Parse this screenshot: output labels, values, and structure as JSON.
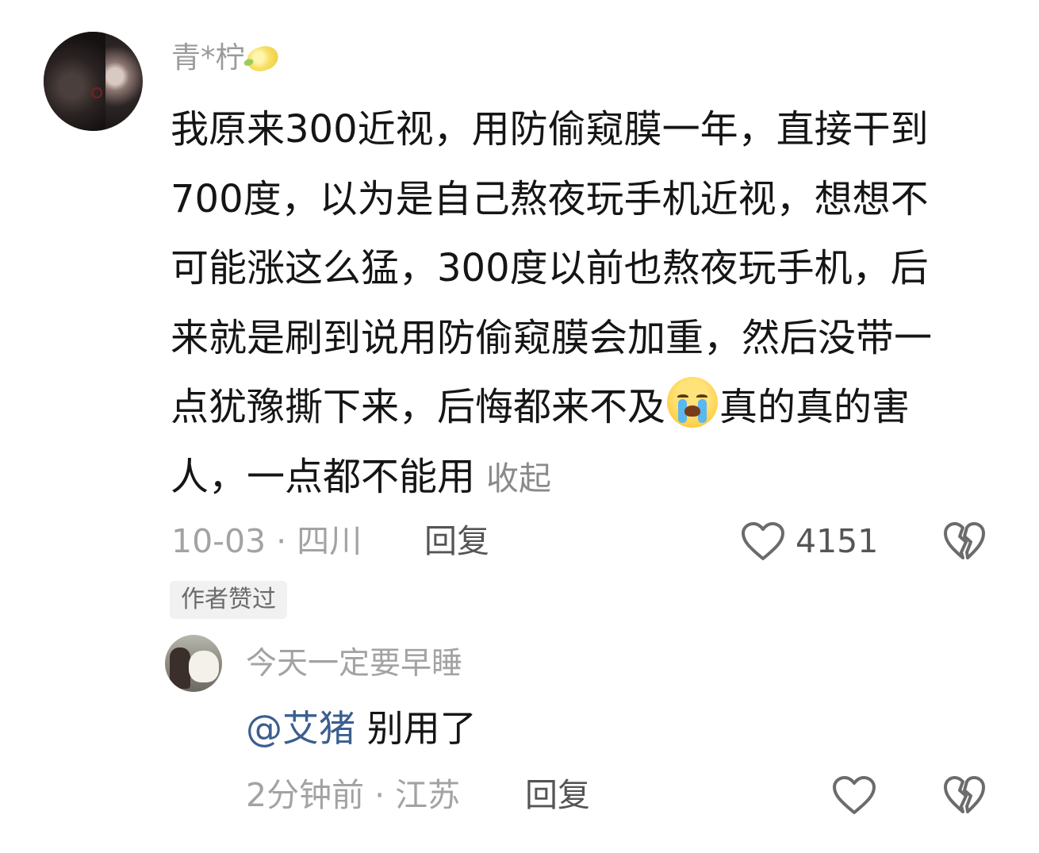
{
  "comment": {
    "username": "青*柠",
    "username_emoji": "lemon-emoji",
    "text_lines": [
      "我原来300近视，用防偷窥膜一年，直接干到",
      "700度，以为是自己熬夜玩手机近视，想想不",
      "可能涨这么猛，300度以前也熬夜玩手机，后",
      "来就是刷到说用防偷窥膜会加重，然后没带一"
    ],
    "line5_before_emoji": "点犹豫撕下来，后悔都来不及",
    "emoji": "loudly-crying-face-emoji",
    "line5_after_emoji": "真的真的害",
    "line6": "人，一点都不能用",
    "collapse_label": "收起",
    "meta": "10-03 · 四川",
    "reply_label": "回复",
    "like_count": "4151",
    "author_liked": "作者赞过",
    "icons": [
      "heart-outline-icon",
      "broken-heart-icon"
    ]
  },
  "reply": {
    "username": "今天一定要早睡",
    "mention": "@艾猪",
    "text": " 别用了",
    "meta": "2分钟前 · 江苏",
    "reply_label": "回复",
    "icons": [
      "heart-outline-icon",
      "broken-heart-icon"
    ],
    "mention_color": "#3a5f8f"
  }
}
